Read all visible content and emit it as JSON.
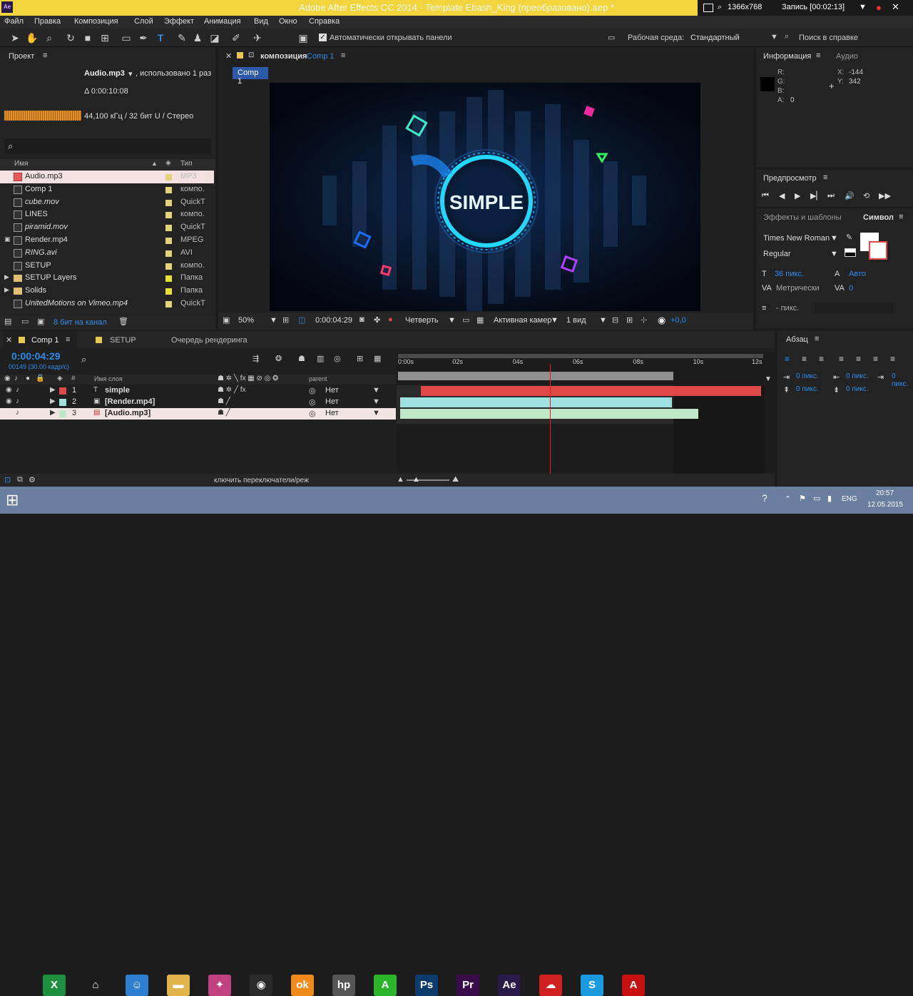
{
  "window": {
    "title": "Adobe After Effects CC 2014 - Template Ebash_King (преобразовано).aep *",
    "app_icon": "Ae"
  },
  "recorder": {
    "resolution": "1366x768",
    "record": "Запись [00:02:13]"
  },
  "menu": [
    "Файл",
    "Правка",
    "Композиция",
    "Слой",
    "Эффект",
    "Анимация",
    "Вид",
    "Окно",
    "Справка"
  ],
  "toolbar": {
    "auto_open": "Автоматически открывать панели",
    "workspace_label": "Рабочая среда:",
    "workspace_value": "Стандартный",
    "help_search": "Поиск в справке"
  },
  "project": {
    "tab": "Проект",
    "selected_name": "Audio.mp3",
    "used": ", использовано 1 раз",
    "duration": "Δ 0:00:10:08",
    "audio_info": "44,100 кГц / 32 бит U / Стерео",
    "col_name": "Имя",
    "col_type": "Тип",
    "bit_depth": "8 бит на канал",
    "items": [
      {
        "name": "Audio.mp3",
        "type": "MP3",
        "color": "#e2d27a"
      },
      {
        "name": "Comp 1",
        "type": "компо.",
        "color": "#e2d27a"
      },
      {
        "name": "cube.mov",
        "type": "QuickT",
        "color": "#e2d27a"
      },
      {
        "name": "LINES",
        "type": "компо.",
        "color": "#e2d27a"
      },
      {
        "name": "piramid.mov",
        "type": "QuickT",
        "color": "#e2d27a"
      },
      {
        "name": "Render.mp4",
        "type": "MPEG",
        "color": "#e2d27a"
      },
      {
        "name": "RING.avi",
        "type": "AVI",
        "color": "#e2d27a"
      },
      {
        "name": "SETUP",
        "type": "компо.",
        "color": "#e2d27a"
      },
      {
        "name": "SETUP Layers",
        "type": "Папка",
        "color": "#e8e032"
      },
      {
        "name": "Solids",
        "type": "Папка",
        "color": "#e8e032"
      },
      {
        "name": "UnitedMotions on Vimeo.mp4",
        "type": "QuickT",
        "color": "#e2d27a"
      }
    ]
  },
  "comp": {
    "tab_prefix": "композиция",
    "tab_name": "Comp 1",
    "subtab": "Comp 1",
    "center_text": "SIMPLE",
    "zoom": "50%",
    "timecode": "0:00:04:29",
    "resolution": "Четверть",
    "camera": "Активная камер",
    "views": "1 вид",
    "exposure": "+0,0"
  },
  "info": {
    "tab": "Информация",
    "tab2": "Аудио",
    "r": "R:",
    "g": "G:",
    "b": "B:",
    "a": "A:",
    "a_val": "0",
    "x": "X:",
    "x_val": "-144",
    "y": "Y:",
    "y_val": "342"
  },
  "preview": {
    "tab": "Предпросмотр"
  },
  "character": {
    "tab1": "Эффекты и шаблоны",
    "tab2": "Символ",
    "font": "Times New Roman",
    "style": "Regular",
    "size": "36 пикс.",
    "leading": "Авто",
    "kerning": "Метрически",
    "tracking": "0",
    "stroke": "- пикс."
  },
  "timeline": {
    "tabs": [
      {
        "name": "Comp 1",
        "color": "#e8c84a"
      },
      {
        "name": "SETUP",
        "color": "#e8c84a"
      },
      {
        "name": "Очередь рендеринга",
        "color": ""
      }
    ],
    "timecode": "0:00:04:29",
    "frames": "00149 (30.00 кадр/с)",
    "col_layer_name": "Имя слоя",
    "col_parent": "parent",
    "layers": [
      {
        "num": "1",
        "name": "simple",
        "parent": "Нет",
        "color": "#e04848",
        "start": 0.058,
        "end": 1.0
      },
      {
        "num": "2",
        "name": "[Render.mp4]",
        "parent": "Нет",
        "color": "#9fe0e0",
        "start": 0.0,
        "end": 0.753
      },
      {
        "num": "3",
        "name": "[Audio.mp3]",
        "parent": "Нет",
        "color": "#bfe8c8",
        "start": 0.0,
        "end": 0.827
      }
    ],
    "ruler": [
      "0:00s",
      "02s",
      "04s",
      "06s",
      "08s",
      "10s",
      "12s"
    ],
    "playhead": 0.415,
    "footer": "ключить переключатели/реж"
  },
  "paragraph": {
    "tab": "Абзац",
    "indent_left": "0 пикс.",
    "indent_right": "0 пикс.",
    "space_before": "0 пикс.",
    "space_after": "0 пикс.",
    "indent_first": "0 пикс."
  },
  "taskbar": {
    "lang": "ENG",
    "time": "20:57",
    "date": "12.05.2015",
    "apps": [
      {
        "icon": "excel-icon",
        "label": "X",
        "color": "#1e8f3e"
      },
      {
        "icon": "home-icon",
        "label": "⌂",
        "color": ""
      },
      {
        "icon": "finder-icon",
        "label": "☺",
        "color": "#2d7fd0"
      },
      {
        "icon": "folder-icon",
        "label": "▬",
        "color": "#e0b44a"
      },
      {
        "icon": "pinwheel-icon",
        "label": "✦",
        "color": "#c04080"
      },
      {
        "icon": "chrome-icon",
        "label": "◉",
        "color": "#2a2a2a"
      },
      {
        "icon": "odnoklassniki-icon",
        "label": "ok",
        "color": "#f08a1a"
      },
      {
        "icon": "hp-icon",
        "label": "hp",
        "color": "#555"
      },
      {
        "icon": "a-icon",
        "label": "A",
        "color": "#2ab52a"
      },
      {
        "icon": "photoshop-icon",
        "label": "Ps",
        "color": "#0b3c6b"
      },
      {
        "icon": "premiere-icon",
        "label": "Pr",
        "color": "#3a0b4a"
      },
      {
        "icon": "aftereffects-icon",
        "label": "Ae",
        "color": "#2a1a4a"
      },
      {
        "icon": "creative-cloud-icon",
        "label": "☁",
        "color": "#d02020"
      },
      {
        "icon": "skype-icon",
        "label": "S",
        "color": "#1a9be0"
      },
      {
        "icon": "acrobat-icon",
        "label": "A",
        "color": "#c81010"
      }
    ]
  }
}
